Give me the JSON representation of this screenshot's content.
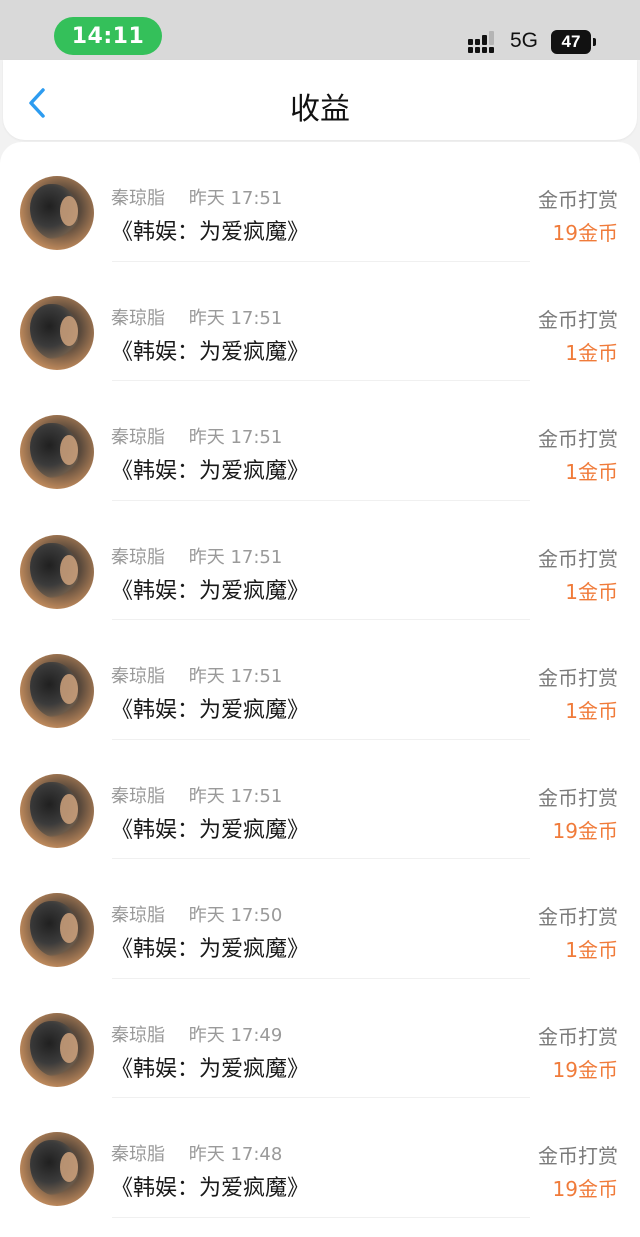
{
  "status_bar": {
    "time": "14:11",
    "network": "5G",
    "battery": "47",
    "time_pill_color": "#34c05a"
  },
  "header": {
    "title": "收益",
    "back_icon": "chevron-left-icon",
    "accent_color": "#2d9cf0"
  },
  "colors": {
    "amount": "#f07b3a",
    "meta": "#9a9a9a"
  },
  "records": [
    {
      "sender": "秦琼脂",
      "time": "昨天 17:51",
      "book": "《韩娱：为爱疯魔》",
      "type": "金币打赏",
      "amount": "19金币"
    },
    {
      "sender": "秦琼脂",
      "time": "昨天 17:51",
      "book": "《韩娱：为爱疯魔》",
      "type": "金币打赏",
      "amount": "1金币"
    },
    {
      "sender": "秦琼脂",
      "time": "昨天 17:51",
      "book": "《韩娱：为爱疯魔》",
      "type": "金币打赏",
      "amount": "1金币"
    },
    {
      "sender": "秦琼脂",
      "time": "昨天 17:51",
      "book": "《韩娱：为爱疯魔》",
      "type": "金币打赏",
      "amount": "1金币"
    },
    {
      "sender": "秦琼脂",
      "time": "昨天 17:51",
      "book": "《韩娱：为爱疯魔》",
      "type": "金币打赏",
      "amount": "1金币"
    },
    {
      "sender": "秦琼脂",
      "time": "昨天 17:51",
      "book": "《韩娱：为爱疯魔》",
      "type": "金币打赏",
      "amount": "19金币"
    },
    {
      "sender": "秦琼脂",
      "time": "昨天 17:50",
      "book": "《韩娱：为爱疯魔》",
      "type": "金币打赏",
      "amount": "1金币"
    },
    {
      "sender": "秦琼脂",
      "time": "昨天 17:49",
      "book": "《韩娱：为爱疯魔》",
      "type": "金币打赏",
      "amount": "19金币"
    },
    {
      "sender": "秦琼脂",
      "time": "昨天 17:48",
      "book": "《韩娱：为爱疯魔》",
      "type": "金币打赏",
      "amount": "19金币"
    }
  ]
}
